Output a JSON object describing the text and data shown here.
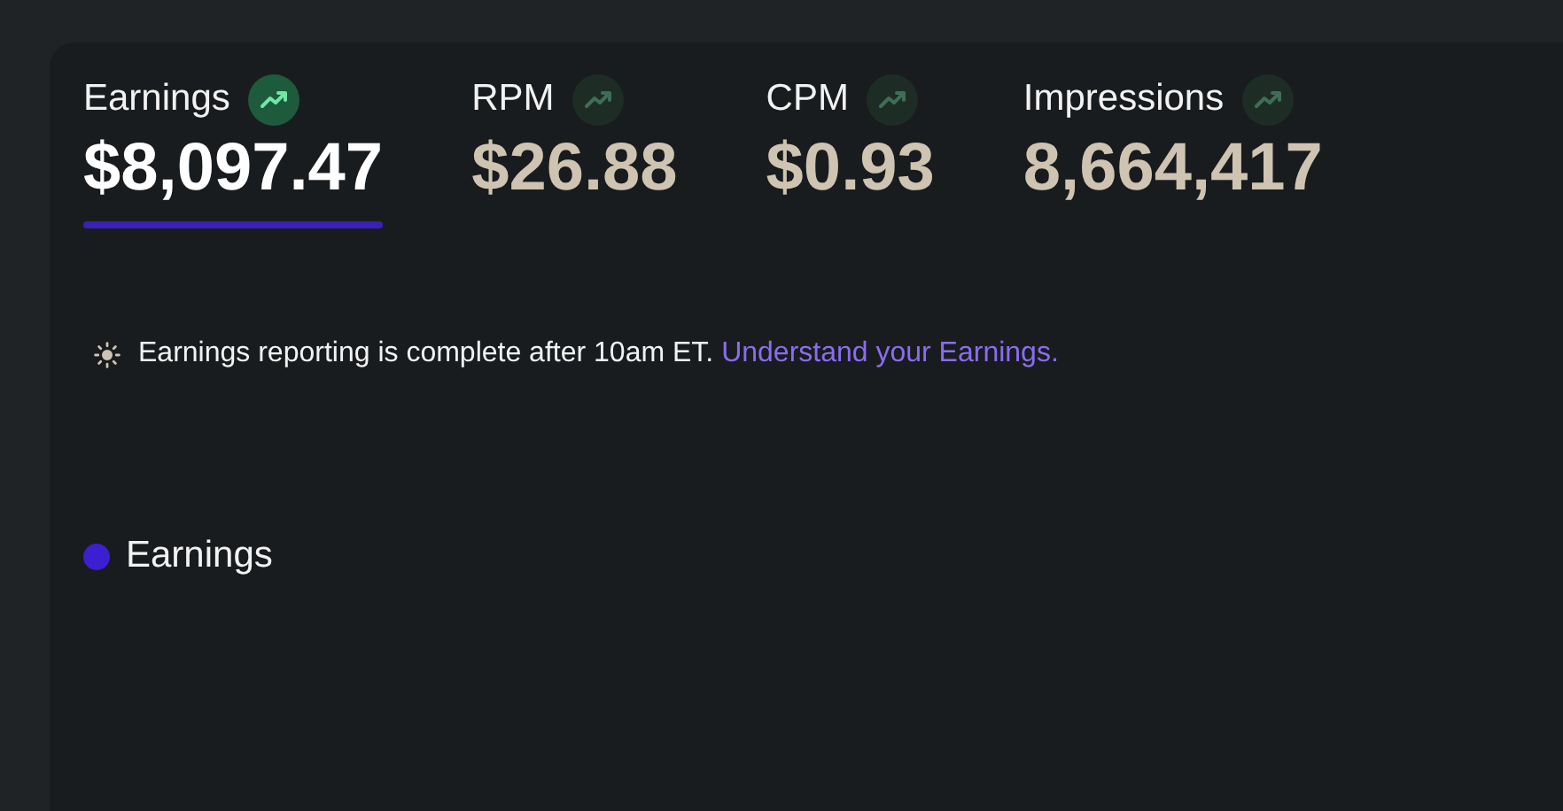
{
  "metrics": [
    {
      "label": "Earnings",
      "value": "$8,097.47",
      "selected": true
    },
    {
      "label": "RPM",
      "value": "$26.88",
      "selected": false
    },
    {
      "label": "CPM",
      "value": "$0.93",
      "selected": false
    },
    {
      "label": "Impressions",
      "value": "8,664,417",
      "selected": false
    }
  ],
  "notice": {
    "text": "Earnings reporting is complete after 10am ET.",
    "link": "Understand your Earnings."
  },
  "legend": [
    {
      "label": "Earnings",
      "color": "#3b1fd1"
    }
  ]
}
